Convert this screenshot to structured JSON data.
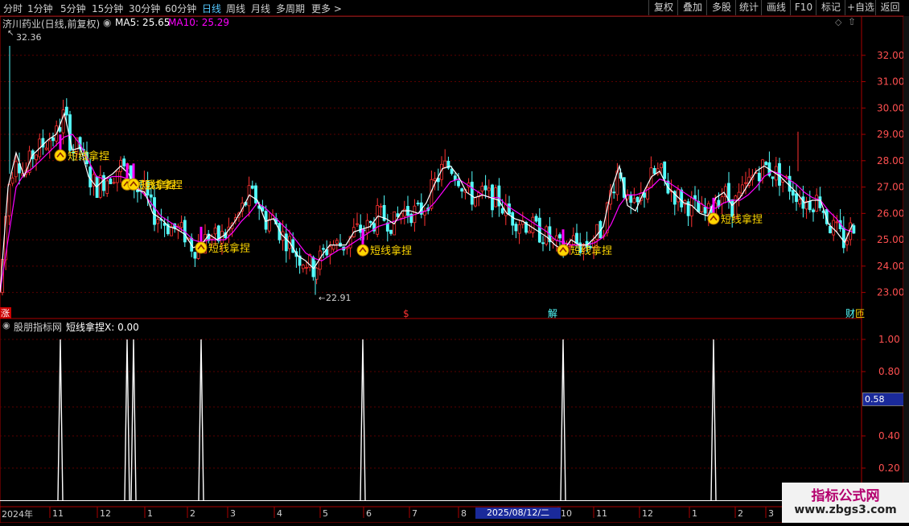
{
  "toolbar": {
    "periods": [
      "分时",
      "1分钟",
      "5分钟",
      "15分钟",
      "30分钟",
      "60分钟",
      "日线",
      "周线",
      "月线",
      "多周期",
      "更多 >"
    ],
    "active_period": "日线",
    "right_buttons": [
      "复权",
      "叠加",
      "多股",
      "统计",
      "画线",
      "F10",
      "标记",
      "+自选",
      "返回"
    ]
  },
  "main": {
    "stock_title": "济川药业(日线,前复权)",
    "ma5_label": "MA5: 25.65",
    "ma10_label": "MA10: 25.29",
    "high_label": "32.36",
    "low_label": "22.91",
    "signal_label": "短线拿捏",
    "y_ticks": [
      "32.00",
      "31.00",
      "30.00",
      "29.00",
      "28.00",
      "27.00",
      "26.00",
      "25.00",
      "24.00",
      "23.00"
    ],
    "markers": [
      "涨",
      "$",
      "解",
      "财",
      "匝"
    ]
  },
  "indicator": {
    "title": "股朋指标网",
    "value_label": "短线拿捏X: 0.00",
    "y_ticks": [
      "1.00",
      "0.80",
      "0.58",
      "0.40",
      "0.20"
    ],
    "current_value": "0.58"
  },
  "xaxis": {
    "year_label": "2024年",
    "month_labels": [
      "11",
      "12",
      "1",
      "2",
      "3",
      "4",
      "5",
      "6",
      "7",
      "8",
      "10",
      "11",
      "12",
      "1",
      "2",
      "3"
    ],
    "selected_date": "2025/08/12/二"
  },
  "watermark": {
    "line1": "指标公式网",
    "line2": "www.zbgs3.com"
  },
  "colors": {
    "up": "#ff3232",
    "down": "#54ffff",
    "ma5": "#ffffff",
    "ma10": "#ff00ff",
    "signal": "#ffd700",
    "grid": "#5a0000",
    "axis": "#aa0000"
  },
  "chart_data": [
    {
      "type": "candlestick",
      "title": "济川药业(日线,前复权)",
      "ylim": [
        22.5,
        33
      ],
      "y_ticks": [
        23,
        24,
        25,
        26,
        27,
        28,
        29,
        30,
        31,
        32
      ],
      "visible_high": 32.36,
      "visible_low": 22.91,
      "series": [
        {
          "name": "MA5",
          "last": 25.65
        },
        {
          "name": "MA10",
          "last": 25.29
        }
      ],
      "ma5_path": [
        [
          0,
          23.0
        ],
        [
          10,
          27.0
        ],
        [
          20,
          28.3
        ],
        [
          30,
          27.4
        ],
        [
          40,
          28.2
        ],
        [
          50,
          28.5
        ],
        [
          60,
          28.8
        ],
        [
          70,
          29.0
        ],
        [
          80,
          29.8
        ],
        [
          90,
          28.4
        ],
        [
          100,
          28.5
        ],
        [
          110,
          27.4
        ],
        [
          120,
          27.0
        ],
        [
          130,
          27.3
        ],
        [
          140,
          27.5
        ],
        [
          150,
          27.8
        ],
        [
          160,
          27.5
        ],
        [
          170,
          26.9
        ],
        [
          180,
          26.8
        ],
        [
          190,
          26.0
        ],
        [
          200,
          25.8
        ],
        [
          210,
          25.5
        ],
        [
          220,
          25.4
        ],
        [
          230,
          25.2
        ],
        [
          240,
          24.7
        ],
        [
          250,
          24.8
        ],
        [
          260,
          25.2
        ],
        [
          270,
          25.0
        ],
        [
          280,
          25.2
        ],
        [
          290,
          25.6
        ],
        [
          300,
          26.1
        ],
        [
          310,
          26.7
        ],
        [
          320,
          26.5
        ],
        [
          330,
          25.7
        ],
        [
          340,
          25.8
        ],
        [
          350,
          25.2
        ],
        [
          360,
          24.9
        ],
        [
          370,
          24.4
        ],
        [
          380,
          24.2
        ],
        [
          390,
          23.9
        ],
        [
          400,
          24.4
        ],
        [
          410,
          24.8
        ],
        [
          420,
          24.8
        ],
        [
          430,
          24.8
        ],
        [
          440,
          25.3
        ],
        [
          450,
          25.4
        ],
        [
          460,
          25.5
        ],
        [
          470,
          25.9
        ],
        [
          480,
          25.8
        ],
        [
          490,
          25.6
        ],
        [
          500,
          26.1
        ],
        [
          510,
          26.1
        ],
        [
          520,
          26.0
        ],
        [
          530,
          26.4
        ],
        [
          540,
          27.1
        ],
        [
          550,
          27.7
        ],
        [
          560,
          27.8
        ],
        [
          570,
          27.4
        ],
        [
          580,
          26.8
        ],
        [
          590,
          26.6
        ],
        [
          600,
          26.7
        ],
        [
          610,
          26.6
        ],
        [
          620,
          26.5
        ],
        [
          630,
          26.0
        ],
        [
          640,
          25.8
        ],
        [
          650,
          25.7
        ],
        [
          660,
          25.5
        ],
        [
          670,
          25.3
        ],
        [
          680,
          25.1
        ],
        [
          690,
          24.8
        ],
        [
          700,
          24.6
        ],
        [
          710,
          25.0
        ],
        [
          720,
          24.8
        ],
        [
          730,
          24.8
        ],
        [
          740,
          25.1
        ],
        [
          750,
          25.5
        ],
        [
          760,
          26.9
        ],
        [
          770,
          27.8
        ],
        [
          780,
          26.3
        ],
        [
          790,
          26.1
        ],
        [
          800,
          26.8
        ],
        [
          810,
          27.4
        ],
        [
          820,
          27.6
        ],
        [
          830,
          27.0
        ],
        [
          840,
          26.7
        ],
        [
          850,
          26.4
        ],
        [
          860,
          26.3
        ],
        [
          870,
          26.0
        ],
        [
          880,
          25.9
        ],
        [
          890,
          26.6
        ],
        [
          900,
          26.8
        ],
        [
          910,
          26.3
        ],
        [
          920,
          26.6
        ],
        [
          930,
          27.1
        ],
        [
          940,
          27.6
        ],
        [
          950,
          27.8
        ],
        [
          960,
          27.6
        ],
        [
          970,
          27.4
        ],
        [
          980,
          27.1
        ],
        [
          990,
          26.8
        ],
        [
          1000,
          26.4
        ],
        [
          1010,
          26.5
        ],
        [
          1020,
          26.5
        ],
        [
          1030,
          25.6
        ],
        [
          1040,
          25.3
        ],
        [
          1050,
          24.9
        ],
        [
          1060,
          25.6
        ]
      ],
      "ma10_path": [
        [
          0,
          23.0
        ],
        [
          10,
          25.0
        ],
        [
          20,
          27.0
        ],
        [
          30,
          27.5
        ],
        [
          40,
          27.7
        ],
        [
          50,
          28.0
        ],
        [
          60,
          28.3
        ],
        [
          70,
          28.6
        ],
        [
          80,
          28.9
        ],
        [
          90,
          29.0
        ],
        [
          100,
          28.6
        ],
        [
          110,
          28.0
        ],
        [
          120,
          27.4
        ],
        [
          130,
          27.3
        ],
        [
          140,
          27.4
        ],
        [
          150,
          27.4
        ],
        [
          160,
          27.3
        ],
        [
          170,
          27.0
        ],
        [
          180,
          26.7
        ],
        [
          190,
          26.3
        ],
        [
          200,
          25.9
        ],
        [
          210,
          25.7
        ],
        [
          220,
          25.5
        ],
        [
          230,
          25.3
        ],
        [
          240,
          25.0
        ],
        [
          250,
          24.9
        ],
        [
          260,
          25.0
        ],
        [
          270,
          25.0
        ],
        [
          280,
          25.0
        ],
        [
          290,
          25.3
        ],
        [
          300,
          25.7
        ],
        [
          310,
          26.0
        ],
        [
          320,
          26.4
        ],
        [
          330,
          26.2
        ],
        [
          340,
          25.9
        ],
        [
          350,
          25.6
        ],
        [
          360,
          25.3
        ],
        [
          370,
          24.9
        ],
        [
          380,
          24.5
        ],
        [
          390,
          24.3
        ],
        [
          400,
          24.2
        ],
        [
          410,
          24.4
        ],
        [
          420,
          24.6
        ],
        [
          430,
          24.7
        ],
        [
          440,
          24.9
        ],
        [
          450,
          25.1
        ],
        [
          460,
          25.3
        ],
        [
          470,
          25.5
        ],
        [
          480,
          25.6
        ],
        [
          490,
          25.7
        ],
        [
          500,
          25.8
        ],
        [
          510,
          25.9
        ],
        [
          520,
          26.0
        ],
        [
          530,
          26.1
        ],
        [
          540,
          26.4
        ],
        [
          550,
          26.8
        ],
        [
          560,
          27.2
        ],
        [
          570,
          27.3
        ],
        [
          580,
          27.1
        ],
        [
          590,
          26.9
        ],
        [
          600,
          26.7
        ],
        [
          610,
          26.6
        ],
        [
          620,
          26.6
        ],
        [
          630,
          26.3
        ],
        [
          640,
          26.1
        ],
        [
          650,
          25.9
        ],
        [
          660,
          25.7
        ],
        [
          670,
          25.5
        ],
        [
          680,
          25.3
        ],
        [
          690,
          25.0
        ],
        [
          700,
          24.9
        ],
        [
          710,
          24.8
        ],
        [
          720,
          24.8
        ],
        [
          730,
          24.8
        ],
        [
          740,
          24.9
        ],
        [
          750,
          25.1
        ],
        [
          760,
          25.6
        ],
        [
          770,
          26.3
        ],
        [
          780,
          26.7
        ],
        [
          790,
          26.7
        ],
        [
          800,
          26.8
        ],
        [
          810,
          27.0
        ],
        [
          820,
          27.3
        ],
        [
          830,
          27.2
        ],
        [
          840,
          27.0
        ],
        [
          850,
          26.8
        ],
        [
          860,
          26.6
        ],
        [
          870,
          26.4
        ],
        [
          880,
          26.2
        ],
        [
          890,
          26.2
        ],
        [
          900,
          26.4
        ],
        [
          910,
          26.5
        ],
        [
          920,
          26.5
        ],
        [
          930,
          26.7
        ],
        [
          940,
          27.0
        ],
        [
          950,
          27.4
        ],
        [
          960,
          27.6
        ],
        [
          970,
          27.5
        ],
        [
          980,
          27.3
        ],
        [
          990,
          27.1
        ],
        [
          1000,
          26.8
        ],
        [
          1010,
          26.6
        ],
        [
          1020,
          26.5
        ],
        [
          1030,
          26.1
        ],
        [
          1040,
          25.8
        ],
        [
          1050,
          25.4
        ],
        [
          1060,
          25.3
        ]
      ],
      "signal_points": [
        [
          75,
          28.2
        ],
        [
          158,
          27.1
        ],
        [
          166,
          27.1
        ],
        [
          250,
          24.7
        ],
        [
          451,
          24.6
        ],
        [
          700,
          24.6
        ],
        [
          887,
          25.8
        ]
      ],
      "signal_label": "短线拿捏"
    },
    {
      "type": "line",
      "title": "短线拿捏X",
      "ylim": [
        0,
        1.05
      ],
      "y_ticks": [
        0.2,
        0.4,
        0.58,
        0.8,
        1.0
      ],
      "current_value": 0.58,
      "spikes_x": [
        75,
        158,
        166,
        250,
        451,
        700,
        887
      ],
      "spike_value": 1.0
    }
  ]
}
